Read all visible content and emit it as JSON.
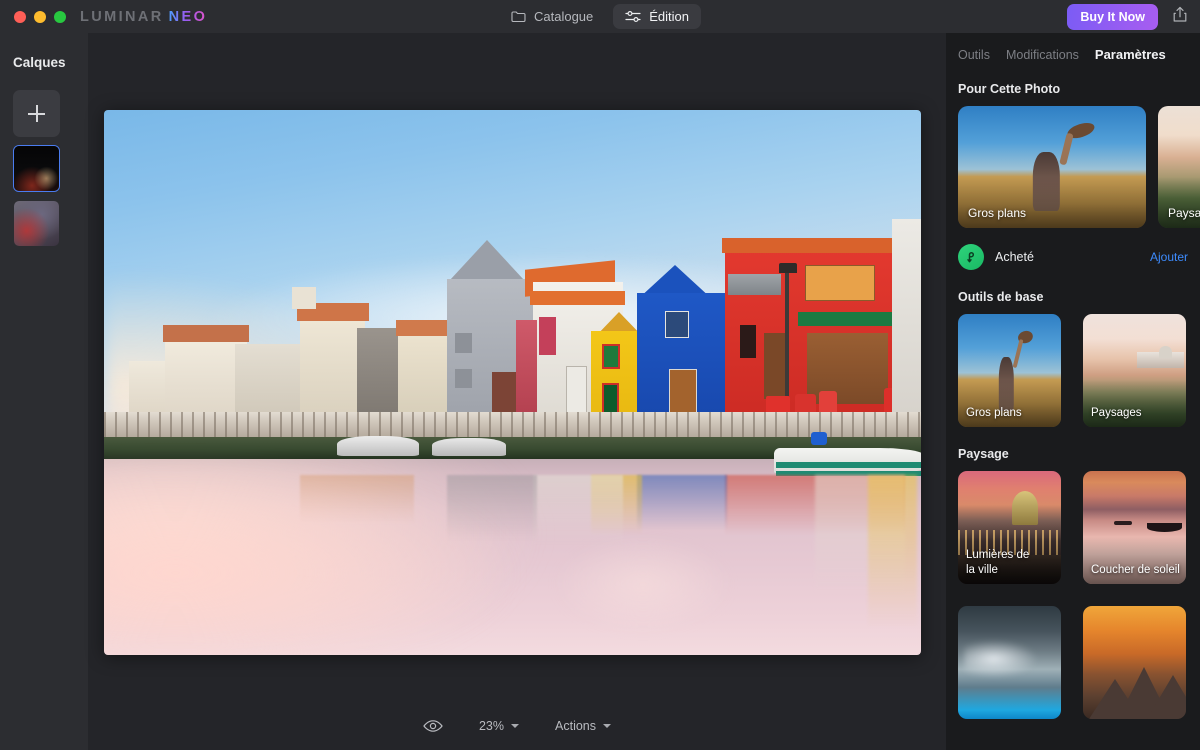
{
  "titlebar": {
    "brand_part1": "LUMINAR",
    "brand_part2": "NEO",
    "tabs": [
      {
        "label": "Catalogue",
        "icon": "folder-icon",
        "active": false
      },
      {
        "label": "Édition",
        "icon": "sliders-icon",
        "active": true
      }
    ],
    "buy_button": "Buy It Now",
    "share_icon": "share-icon"
  },
  "layers_panel": {
    "title": "Calques",
    "add_button_icon": "plus-icon",
    "layers": [
      {
        "name": "layer-thumbnail-1",
        "selected": true
      },
      {
        "name": "layer-thumbnail-2",
        "selected": false
      },
      {
        "name": "layer-thumbnail-3",
        "selected": false
      }
    ]
  },
  "bottom_bar": {
    "visibility_icon": "eye-icon",
    "zoom_level": "23%",
    "actions_label": "Actions",
    "chevron_icon": "chevron-down-icon"
  },
  "right_panel": {
    "tabs": [
      {
        "label": "Outils",
        "active": false
      },
      {
        "label": "Modifications",
        "active": false
      },
      {
        "label": "Paramètres",
        "active": true
      }
    ],
    "sections": [
      {
        "title": "Pour Cette Photo",
        "layout": "carousel",
        "cards": [
          {
            "label": "Gros plans",
            "art": "art-field"
          },
          {
            "label": "Paysa",
            "art": "art-paysa"
          }
        ]
      },
      {
        "title": "Outils de base",
        "layout": "grid",
        "cards": [
          {
            "label": "Gros plans",
            "art": "art-field"
          },
          {
            "label": "Paysages",
            "art": "art-land"
          }
        ]
      },
      {
        "title": "Paysage",
        "layout": "grid",
        "cards": [
          {
            "label": "Lumières de\nla ville",
            "art": "art-city"
          },
          {
            "label": "Coucher de soleil",
            "art": "art-sunset"
          },
          {
            "label": "",
            "art": "art-storm"
          },
          {
            "label": "",
            "art": "art-mtn"
          }
        ]
      }
    ],
    "purchased_row": {
      "badge_icon": "purchased-badge-icon",
      "label": "Acheté",
      "action_label": "Ajouter"
    }
  },
  "canvas": {
    "photo_alt": "Canal scene with colorful houses and reflection",
    "accent_selection": "#4a7cf0",
    "panel_bg": "#1a1b1d",
    "canvas_bg": "#242529",
    "chrome_bg": "#2c2d31"
  }
}
